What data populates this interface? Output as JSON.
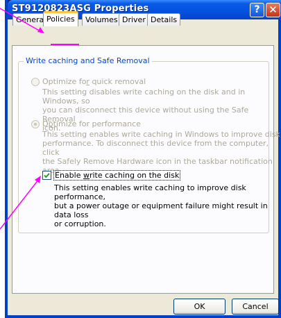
{
  "window": {
    "title": "ST9120823ASG Properties",
    "help_glyph": "?",
    "close_glyph": "✕"
  },
  "tabs": [
    {
      "label": "General",
      "active": false
    },
    {
      "label": "Policies",
      "active": true
    },
    {
      "label": "Volumes",
      "active": false
    },
    {
      "label": "Driver",
      "active": false
    },
    {
      "label": "Details",
      "active": false
    }
  ],
  "group": {
    "label": "Write caching and Safe Removal"
  },
  "options": {
    "quick_removal": {
      "label": "Optimize for quick removal",
      "mnemonic": "r",
      "description": [
        "This setting disables write caching on the disk and in Windows, so",
        "you can disconnect this device without using the Safe Removal",
        "icon."
      ],
      "selected": false,
      "enabled": false
    },
    "performance": {
      "label": "Optimize for performance",
      "mnemonic": "p",
      "description": [
        "This setting enables write caching in Windows to improve disk",
        "performance. To disconnect this device from the computer, click",
        "the Safely Remove Hardware icon in the taskbar notification area."
      ],
      "selected": true,
      "enabled": false
    },
    "write_caching": {
      "label": "Enable write caching on the disk",
      "mnemonic": "w",
      "description": [
        "This setting enables write caching to improve disk performance,",
        "but a power outage or equipment failure might result in data loss",
        "or corruption."
      ],
      "checked": true,
      "enabled": true
    }
  },
  "buttons": {
    "ok": "OK",
    "cancel": "Cancel"
  },
  "colors": {
    "annotation": "#ff00ff",
    "xp_blue": "#0551e0",
    "tab_highlight": "#ffc83c",
    "group_label": "#0046d5",
    "disabled_text": "#aca899"
  }
}
